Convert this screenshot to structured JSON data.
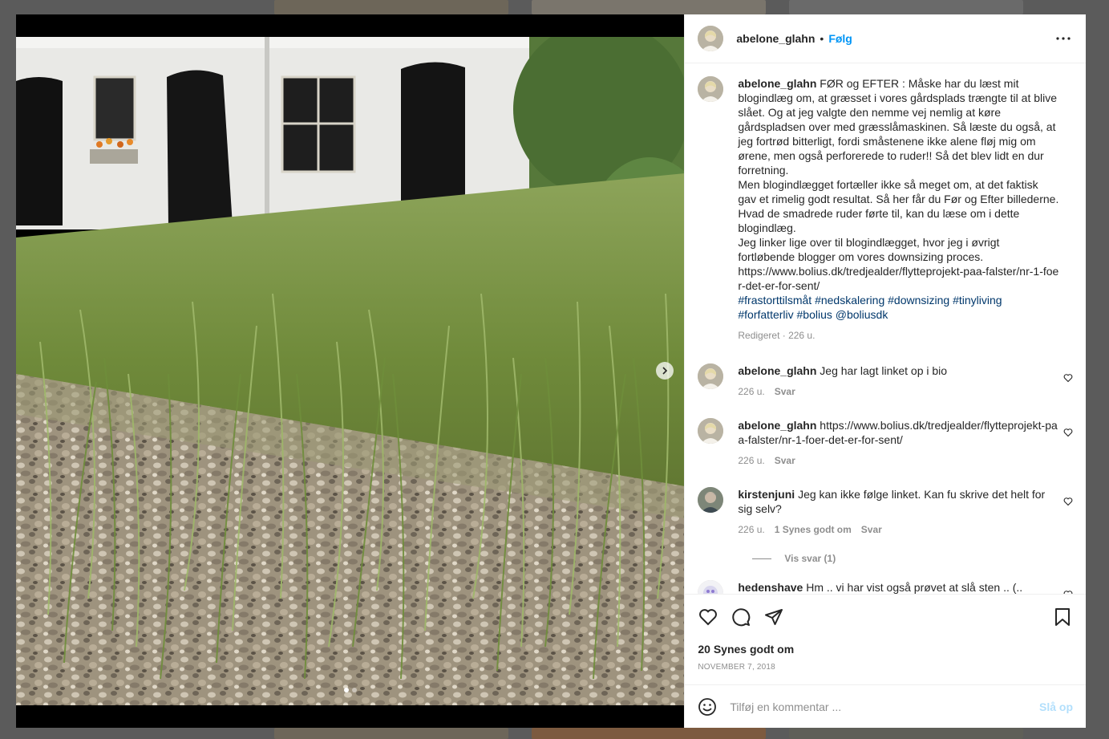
{
  "post": {
    "username": "abelone_glahn",
    "separator": "•",
    "follow_label": "Følg",
    "caption_user": "abelone_glahn",
    "caption_lines": [
      "FØR og EFTER : Måske har du læst mit blogindlæg om, at græsset i vores gårdsplads trængte til at blive slået. Og at jeg valgte den nemme vej nemlig at køre gårdspladsen over med græsslåmaskinen. Så læste du også, at jeg fortrød bitterligt, fordi småstenene ikke alene fløj mig om ørene, men også perforerede to ruder!! Så det blev lidt en dur forretning.",
      "Men blogindlægget fortæller ikke så meget om, at det faktisk gav et rimelig godt resultat. Så her får du Før og Efter billederne. Hvad de smadrede ruder førte til, kan du læse om i dette blogindlæg.",
      "Jeg linker lige over til blogindlægget, hvor jeg i øvrigt fortløbende blogger om vores downsizing proces.",
      "https://www.bolius.dk/tredjealder/flytteprojekt-paa-falster/nr-1-foer-det-er-for-sent/"
    ],
    "hashtags_line1": "#frastorttilsmåt #nedskalering #downsizing #tinyliving",
    "hashtags_line2": "#forfatterliv #bolius @boliusdk",
    "caption_meta": "Redigeret · 226 u.",
    "likes": "20 Synes godt om",
    "date": "NOVEMBER 7, 2018"
  },
  "comments": [
    {
      "user": "abelone_glahn",
      "text": "Jeg har lagt linket op i bio",
      "age": "226 u.",
      "likes": "",
      "reply": "Svar"
    },
    {
      "user": "abelone_glahn",
      "text": "https://www.bolius.dk/tredjealder/flytteprojekt-paa-falster/nr-1-foer-det-er-for-sent/",
      "age": "226 u.",
      "likes": "",
      "reply": "Svar"
    },
    {
      "user": "kirstenjuni",
      "text": "Jeg kan ikke følge linket. Kan fu skrive det helt for sig selv?",
      "age": "226 u.",
      "likes": "1 Synes godt om",
      "reply": "Svar"
    },
    {
      "user": "hedenshave",
      "text": "Hm .. vi har vist også prøvet at slå sten .. (..",
      "age": "",
      "likes": "",
      "reply": ""
    }
  ],
  "view_replies": "Vis svar (1)",
  "add_comment": {
    "placeholder": "Tilføj en kommentar ...",
    "post_label": "Slå op"
  },
  "colors": {
    "accent": "#0095f6",
    "text": "#262626",
    "muted": "#8e8e8e",
    "hashtag": "#00376b"
  },
  "icons": [
    "more-icon",
    "heart-icon",
    "comment-icon",
    "share-icon",
    "save-icon",
    "emoji-icon",
    "next-arrow-icon"
  ]
}
